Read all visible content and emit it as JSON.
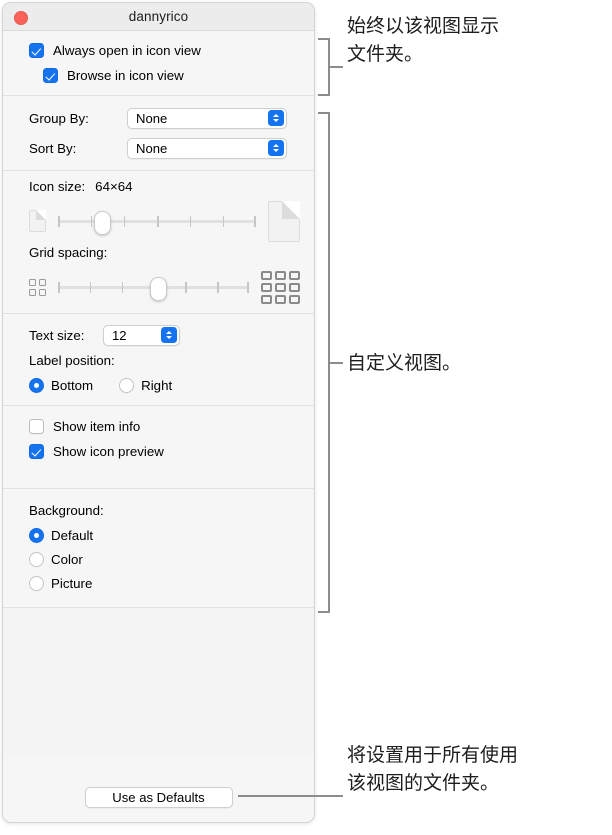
{
  "window": {
    "title": "dannyrico",
    "close_button": "close-button"
  },
  "view_section": {
    "always_open": {
      "label": "Always open in icon view",
      "checked": true
    },
    "browse_in_icon_view": {
      "label": "Browse in icon view",
      "checked": true
    }
  },
  "arrange_section": {
    "group_by": {
      "label": "Group By:",
      "value": "None"
    },
    "sort_by": {
      "label": "Sort By:",
      "value": "None"
    }
  },
  "size_section": {
    "icon_size": {
      "label": "Icon size:",
      "value": "64×64",
      "slider_percent": 22,
      "ticks": 7,
      "min_icon": "small-document-icon",
      "max_icon": "large-document-icon"
    },
    "grid_spacing": {
      "label": "Grid spacing:",
      "slider_percent": 52,
      "ticks": 7,
      "min_icon": "small-grid-icon",
      "max_icon": "large-grid-icon"
    }
  },
  "text_section": {
    "text_size": {
      "label": "Text size:",
      "value": "12"
    },
    "label_position": {
      "label": "Label position:",
      "options": [
        {
          "label": "Bottom",
          "selected": true
        },
        {
          "label": "Right",
          "selected": false
        }
      ]
    }
  },
  "info_section": {
    "show_item_info": {
      "label": "Show item info",
      "checked": false
    },
    "show_icon_preview": {
      "label": "Show icon preview",
      "checked": true
    }
  },
  "background_section": {
    "label": "Background:",
    "options": [
      {
        "label": "Default",
        "selected": true
      },
      {
        "label": "Color",
        "selected": false
      },
      {
        "label": "Picture",
        "selected": false
      }
    ]
  },
  "footer": {
    "use_as_defaults": "Use as Defaults"
  },
  "callouts": [
    {
      "text": "始终以该视图显示\n文件夹。"
    },
    {
      "text": "自定义视图。"
    },
    {
      "text": "将设置用于所有使用\n该视图的文件夹。"
    }
  ],
  "colors": {
    "accent": "#1573f0",
    "close": "#fa6159",
    "window_bg": "#f6f6f6",
    "callout_line": "#8c8c8c"
  }
}
